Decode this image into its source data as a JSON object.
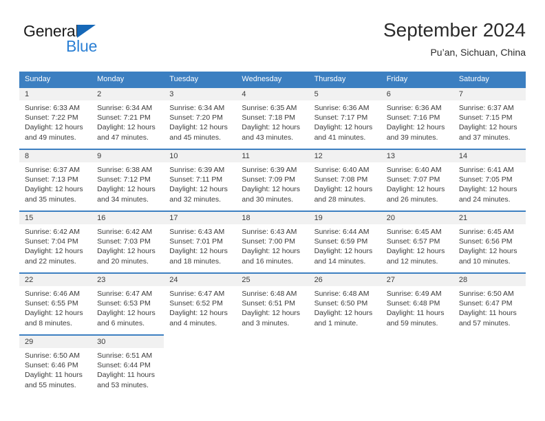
{
  "brand": {
    "name_top": "General",
    "name_bottom": "Blue",
    "color_top": "#1a1a1a",
    "color_bottom": "#2a7fd4",
    "triangle_color": "#1668b8"
  },
  "header": {
    "title": "September 2024",
    "subtitle": "Pu’an, Sichuan, China"
  },
  "theme": {
    "header_row_bg": "#3c7fc1",
    "header_row_text": "#ffffff",
    "day_band_bg": "#f1f1f1",
    "cell_text": "#3a3a3a",
    "row_rule": "#3c7fc1"
  },
  "weekdays": [
    "Sunday",
    "Monday",
    "Tuesday",
    "Wednesday",
    "Thursday",
    "Friday",
    "Saturday"
  ],
  "weeks": [
    [
      {
        "day": "1",
        "sunrise": "Sunrise: 6:33 AM",
        "sunset": "Sunset: 7:22 PM",
        "daylight": "Daylight: 12 hours and 49 minutes."
      },
      {
        "day": "2",
        "sunrise": "Sunrise: 6:34 AM",
        "sunset": "Sunset: 7:21 PM",
        "daylight": "Daylight: 12 hours and 47 minutes."
      },
      {
        "day": "3",
        "sunrise": "Sunrise: 6:34 AM",
        "sunset": "Sunset: 7:20 PM",
        "daylight": "Daylight: 12 hours and 45 minutes."
      },
      {
        "day": "4",
        "sunrise": "Sunrise: 6:35 AM",
        "sunset": "Sunset: 7:18 PM",
        "daylight": "Daylight: 12 hours and 43 minutes."
      },
      {
        "day": "5",
        "sunrise": "Sunrise: 6:36 AM",
        "sunset": "Sunset: 7:17 PM",
        "daylight": "Daylight: 12 hours and 41 minutes."
      },
      {
        "day": "6",
        "sunrise": "Sunrise: 6:36 AM",
        "sunset": "Sunset: 7:16 PM",
        "daylight": "Daylight: 12 hours and 39 minutes."
      },
      {
        "day": "7",
        "sunrise": "Sunrise: 6:37 AM",
        "sunset": "Sunset: 7:15 PM",
        "daylight": "Daylight: 12 hours and 37 minutes."
      }
    ],
    [
      {
        "day": "8",
        "sunrise": "Sunrise: 6:37 AM",
        "sunset": "Sunset: 7:13 PM",
        "daylight": "Daylight: 12 hours and 35 minutes."
      },
      {
        "day": "9",
        "sunrise": "Sunrise: 6:38 AM",
        "sunset": "Sunset: 7:12 PM",
        "daylight": "Daylight: 12 hours and 34 minutes."
      },
      {
        "day": "10",
        "sunrise": "Sunrise: 6:39 AM",
        "sunset": "Sunset: 7:11 PM",
        "daylight": "Daylight: 12 hours and 32 minutes."
      },
      {
        "day": "11",
        "sunrise": "Sunrise: 6:39 AM",
        "sunset": "Sunset: 7:09 PM",
        "daylight": "Daylight: 12 hours and 30 minutes."
      },
      {
        "day": "12",
        "sunrise": "Sunrise: 6:40 AM",
        "sunset": "Sunset: 7:08 PM",
        "daylight": "Daylight: 12 hours and 28 minutes."
      },
      {
        "day": "13",
        "sunrise": "Sunrise: 6:40 AM",
        "sunset": "Sunset: 7:07 PM",
        "daylight": "Daylight: 12 hours and 26 minutes."
      },
      {
        "day": "14",
        "sunrise": "Sunrise: 6:41 AM",
        "sunset": "Sunset: 7:05 PM",
        "daylight": "Daylight: 12 hours and 24 minutes."
      }
    ],
    [
      {
        "day": "15",
        "sunrise": "Sunrise: 6:42 AM",
        "sunset": "Sunset: 7:04 PM",
        "daylight": "Daylight: 12 hours and 22 minutes."
      },
      {
        "day": "16",
        "sunrise": "Sunrise: 6:42 AM",
        "sunset": "Sunset: 7:03 PM",
        "daylight": "Daylight: 12 hours and 20 minutes."
      },
      {
        "day": "17",
        "sunrise": "Sunrise: 6:43 AM",
        "sunset": "Sunset: 7:01 PM",
        "daylight": "Daylight: 12 hours and 18 minutes."
      },
      {
        "day": "18",
        "sunrise": "Sunrise: 6:43 AM",
        "sunset": "Sunset: 7:00 PM",
        "daylight": "Daylight: 12 hours and 16 minutes."
      },
      {
        "day": "19",
        "sunrise": "Sunrise: 6:44 AM",
        "sunset": "Sunset: 6:59 PM",
        "daylight": "Daylight: 12 hours and 14 minutes."
      },
      {
        "day": "20",
        "sunrise": "Sunrise: 6:45 AM",
        "sunset": "Sunset: 6:57 PM",
        "daylight": "Daylight: 12 hours and 12 minutes."
      },
      {
        "day": "21",
        "sunrise": "Sunrise: 6:45 AM",
        "sunset": "Sunset: 6:56 PM",
        "daylight": "Daylight: 12 hours and 10 minutes."
      }
    ],
    [
      {
        "day": "22",
        "sunrise": "Sunrise: 6:46 AM",
        "sunset": "Sunset: 6:55 PM",
        "daylight": "Daylight: 12 hours and 8 minutes."
      },
      {
        "day": "23",
        "sunrise": "Sunrise: 6:47 AM",
        "sunset": "Sunset: 6:53 PM",
        "daylight": "Daylight: 12 hours and 6 minutes."
      },
      {
        "day": "24",
        "sunrise": "Sunrise: 6:47 AM",
        "sunset": "Sunset: 6:52 PM",
        "daylight": "Daylight: 12 hours and 4 minutes."
      },
      {
        "day": "25",
        "sunrise": "Sunrise: 6:48 AM",
        "sunset": "Sunset: 6:51 PM",
        "daylight": "Daylight: 12 hours and 3 minutes."
      },
      {
        "day": "26",
        "sunrise": "Sunrise: 6:48 AM",
        "sunset": "Sunset: 6:50 PM",
        "daylight": "Daylight: 12 hours and 1 minute."
      },
      {
        "day": "27",
        "sunrise": "Sunrise: 6:49 AM",
        "sunset": "Sunset: 6:48 PM",
        "daylight": "Daylight: 11 hours and 59 minutes."
      },
      {
        "day": "28",
        "sunrise": "Sunrise: 6:50 AM",
        "sunset": "Sunset: 6:47 PM",
        "daylight": "Daylight: 11 hours and 57 minutes."
      }
    ],
    [
      {
        "day": "29",
        "sunrise": "Sunrise: 6:50 AM",
        "sunset": "Sunset: 6:46 PM",
        "daylight": "Daylight: 11 hours and 55 minutes."
      },
      {
        "day": "30",
        "sunrise": "Sunrise: 6:51 AM",
        "sunset": "Sunset: 6:44 PM",
        "daylight": "Daylight: 11 hours and 53 minutes."
      },
      null,
      null,
      null,
      null,
      null
    ]
  ]
}
